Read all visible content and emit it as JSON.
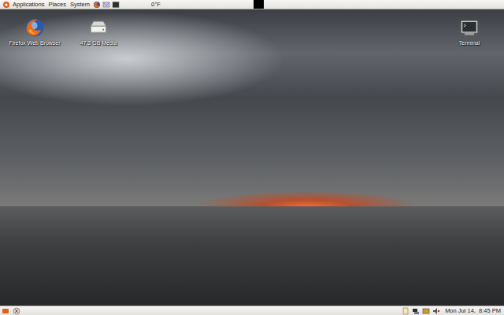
{
  "top_panel": {
    "menus": [
      {
        "label": "Applications"
      },
      {
        "label": "Places"
      },
      {
        "label": "System"
      }
    ],
    "weather": "0°F"
  },
  "desktop": {
    "icons": [
      {
        "label": "Firefox Web Browser",
        "kind": "firefox"
      },
      {
        "label": "47.3 GB Media",
        "kind": "drive"
      },
      {
        "label": "Terminal",
        "kind": "terminal"
      }
    ]
  },
  "bottom_panel": {
    "clock": "Mon Jul 14,  8:45 PM"
  }
}
